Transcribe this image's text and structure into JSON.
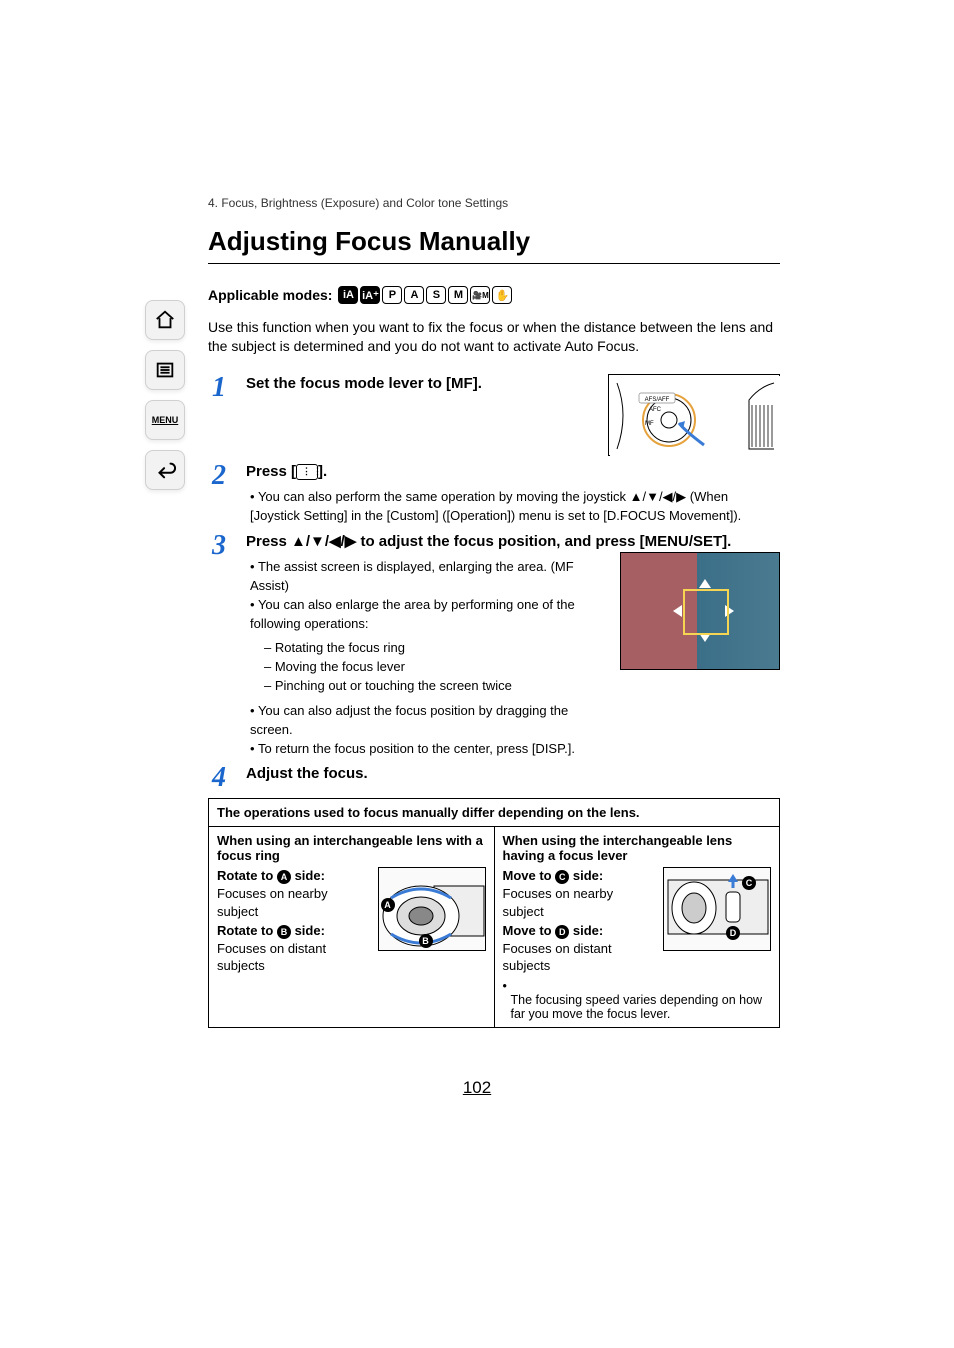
{
  "section_path": "4. Focus, Brightness (Exposure) and Color tone Settings",
  "title": "Adjusting Focus Manually",
  "modes_label": "Applicable modes:",
  "modes": [
    "iA",
    "iA+",
    "P",
    "A",
    "S",
    "M",
    "🎥M",
    "✋"
  ],
  "intro": "Use this function when you want to fix the focus or when the distance between the lens and the subject is determined and you do not want to activate Auto Focus.",
  "steps": {
    "s1": {
      "num": "1",
      "head": "Set the focus mode lever to [MF]."
    },
    "s2": {
      "num": "2",
      "head_prefix": "Press [",
      "head_suffix": "].",
      "bullet": "You can also perform the same operation by moving the joystick ▲/▼/◀/▶ (When [Joystick Setting] in the [Custom] ([Operation]) menu is set to [D.FOCUS Movement])."
    },
    "s3": {
      "num": "3",
      "head": "Press ▲/▼/◀/▶ to adjust the focus position, and press [MENU/SET].",
      "bullets": [
        "The assist screen is displayed, enlarging the area. (MF Assist)",
        "You can also enlarge the area by performing one of the following operations:"
      ],
      "dashes": [
        "Rotating the focus ring",
        "Moving the focus lever",
        "Pinching out or touching the screen twice"
      ],
      "bullets2": [
        "You can also adjust the focus position by dragging the screen.",
        "To return the focus position to the center, press [DISP.]."
      ]
    },
    "s4": {
      "num": "4",
      "head": "Adjust the focus."
    }
  },
  "table": {
    "header": "The operations used to focus manually differ depending on the lens.",
    "left": {
      "title": "When using an interchangeable lens with a focus ring",
      "rotA_label": "Rotate to ",
      "rotA_badge": "A",
      "rotA_suffix": " side:",
      "rotA_text": "Focuses on nearby subject",
      "rotB_label": "Rotate to ",
      "rotB_badge": "B",
      "rotB_suffix": " side:",
      "rotB_text": "Focuses on distant subjects"
    },
    "right": {
      "title": "When using the interchangeable lens having a focus lever",
      "movC_label": "Move to ",
      "movC_badge": "C",
      "movC_suffix": " side:",
      "movC_text": "Focuses on nearby subject",
      "movD_label": "Move to ",
      "movD_badge": "D",
      "movD_suffix": " side:",
      "movD_text": "Focuses on distant subjects",
      "foot": "The focusing speed varies depending on how far you move the focus lever."
    }
  },
  "diagram1_labels": {
    "top": "AFS/AFF",
    "mid": "AFC",
    "bot": "MF"
  },
  "page_number": "102"
}
